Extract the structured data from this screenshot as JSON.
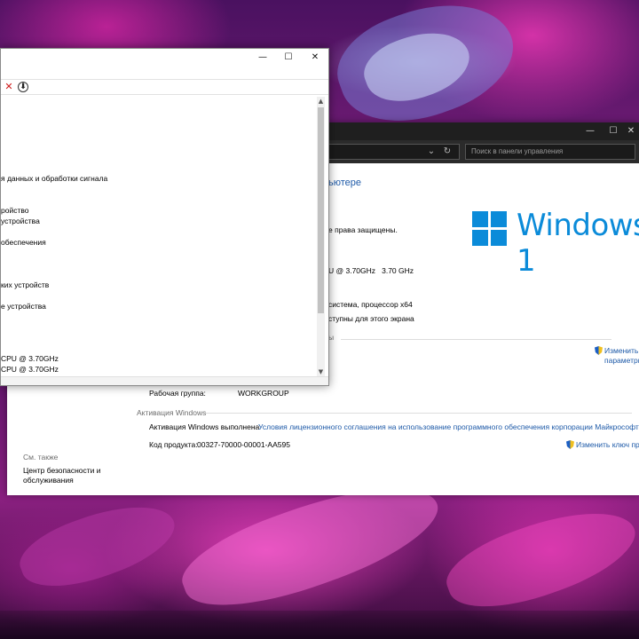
{
  "control_panel": {
    "search_placeholder": "Поиск в панели управления",
    "heading_partial": "ьютере",
    "copyright_partial": "е права защищены.",
    "windows_brand": "Windows 1",
    "processor_partial": "U @ 3.70GHz   3.70 GHz",
    "system_type_partial": "система, процессор x64",
    "pen_touch_partial": "ступны для этого экрана",
    "section_partial": "ы",
    "change_params_line1": "Изменить",
    "change_params_line2": "параметры",
    "workgroup_label": "Рабочая группа:",
    "workgroup_value": "WORKGROUP",
    "activation_section": "Активация Windows",
    "activation_status": "Активация Windows выполнена",
    "license_link": "Условия лицензионного соглашения на использование программного обеспечения корпорации Майкрософт",
    "product_key_label": "Код продукта:",
    "product_key_value": "00327-70000-00001-AA595",
    "change_key_link": "Изменить ключ продук",
    "see_also": "См. также",
    "security_center_line1": "Центр безопасности и",
    "security_center_line2": "обслуживания"
  },
  "device_manager": {
    "items": [
      "я данных и обработки сигнала",
      "ройство",
      "устройства",
      "обеспечения",
      "ких устройств",
      "е устройства",
      "CPU @ 3.70GHz",
      "CPU @ 3.70GHz"
    ]
  },
  "colors": {
    "link": "#1e5aa8",
    "windows_blue": "#0b8bd9",
    "dark_chrome": "#1f1f1f"
  }
}
